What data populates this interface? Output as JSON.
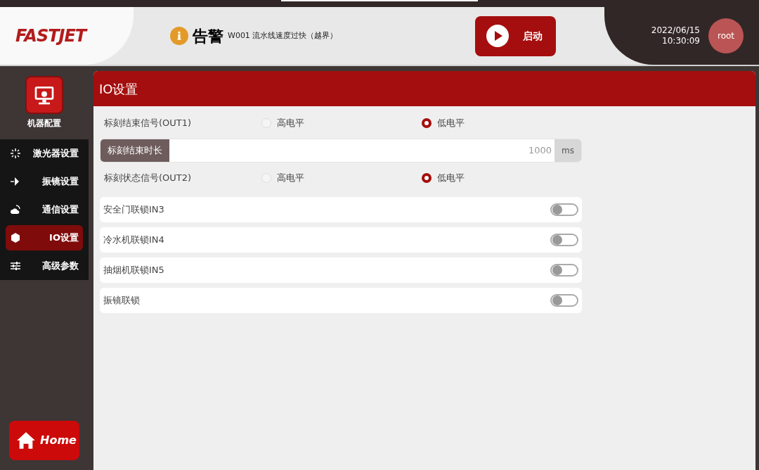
{
  "header": {
    "logo": "FASTJET",
    "alert": {
      "title": "告警",
      "message": "W001 流水线速度过快（越界）"
    },
    "start_button": "启动",
    "date": "2022/06/15",
    "time": "10:30:09",
    "user": "root"
  },
  "sidebar": {
    "title": "机器配置",
    "items": [
      {
        "label": "激光器设置",
        "selected": false
      },
      {
        "label": "振镜设置",
        "selected": false
      },
      {
        "label": "通信设置",
        "selected": false
      },
      {
        "label": "IO设置",
        "selected": true
      },
      {
        "label": "高级参数",
        "selected": false
      }
    ],
    "home_button": "Home"
  },
  "panel": {
    "title": "IO设置",
    "rows": [
      {
        "kind": "radio",
        "label": "标刻结束信号(OUT1)",
        "options": [
          {
            "label": "高电平",
            "selected": false
          },
          {
            "label": "低电平",
            "selected": true
          }
        ]
      },
      {
        "kind": "input",
        "label": "标刻结束时长",
        "value": "1000",
        "unit": "ms"
      },
      {
        "kind": "radio",
        "label": "标刻状态信号(OUT2)",
        "options": [
          {
            "label": "高电平",
            "selected": false
          },
          {
            "label": "低电平",
            "selected": true
          }
        ]
      },
      {
        "kind": "toggle",
        "label": "安全门联锁IN3",
        "on": false
      },
      {
        "kind": "toggle",
        "label": "冷水机联锁IN4",
        "on": false
      },
      {
        "kind": "toggle",
        "label": "抽烟机联锁IN5",
        "on": false
      },
      {
        "kind": "toggle",
        "label": "振镜联锁",
        "on": false
      }
    ]
  }
}
